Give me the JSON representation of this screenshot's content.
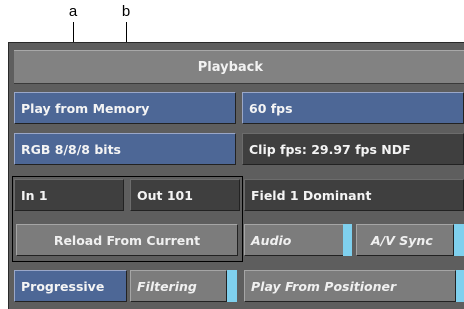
{
  "callouts": {
    "a": "a",
    "b": "b"
  },
  "panel": {
    "title": "Playback",
    "play_from_memory": "Play from Memory",
    "fps": "60 fps",
    "color_depth": "RGB 8/8/8 bits",
    "clip_fps": "Clip fps: 29.97 fps NDF",
    "in_point": "In 1",
    "out_point": "Out 101",
    "field_dominance": "Field 1 Dominant",
    "reload_from_current": "Reload From Current",
    "audio": "Audio",
    "av_sync": "A/V Sync",
    "progressive": "Progressive",
    "filtering": "Filtering",
    "play_from_positioner": "Play From Positioner"
  },
  "colors": {
    "blue_button": "#4d6796",
    "dark_button": "#3f3f3f",
    "grey_button": "#7c7c7c",
    "toggle_accent": "#7fd0ee",
    "header": "#828282"
  }
}
